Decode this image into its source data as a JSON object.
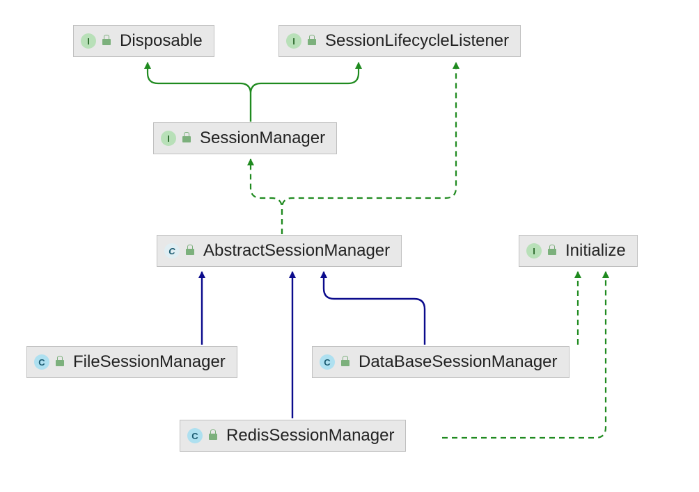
{
  "nodes": {
    "disposable": {
      "label": "Disposable",
      "kind": "interface",
      "badge": "I"
    },
    "sessionLifecycleListener": {
      "label": "SessionLifecycleListener",
      "kind": "interface",
      "badge": "I"
    },
    "sessionManager": {
      "label": "SessionManager",
      "kind": "interface",
      "badge": "I"
    },
    "abstractSessionManager": {
      "label": "AbstractSessionManager",
      "kind": "abstract",
      "badge": "C"
    },
    "initialize": {
      "label": "Initialize",
      "kind": "interface",
      "badge": "I"
    },
    "fileSessionManager": {
      "label": "FileSessionManager",
      "kind": "class",
      "badge": "C"
    },
    "dataBaseSessionManager": {
      "label": "DataBaseSessionManager",
      "kind": "class",
      "badge": "C"
    },
    "redisSessionManager": {
      "label": "RedisSessionManager",
      "kind": "class",
      "badge": "C"
    }
  },
  "edges": [
    {
      "from": "sessionManager",
      "to": "disposable",
      "style": "solid",
      "color": "green"
    },
    {
      "from": "sessionManager",
      "to": "sessionLifecycleListener",
      "style": "solid",
      "color": "green"
    },
    {
      "from": "abstractSessionManager",
      "to": "sessionManager",
      "style": "dashed",
      "color": "green"
    },
    {
      "from": "abstractSessionManager",
      "to": "sessionLifecycleListener",
      "style": "dashed",
      "color": "green"
    },
    {
      "from": "fileSessionManager",
      "to": "abstractSessionManager",
      "style": "solid",
      "color": "navy"
    },
    {
      "from": "dataBaseSessionManager",
      "to": "abstractSessionManager",
      "style": "solid",
      "color": "navy"
    },
    {
      "from": "redisSessionManager",
      "to": "abstractSessionManager",
      "style": "solid",
      "color": "navy"
    },
    {
      "from": "dataBaseSessionManager",
      "to": "initialize",
      "style": "dashed",
      "color": "green"
    },
    {
      "from": "redisSessionManager",
      "to": "initialize",
      "style": "dashed",
      "color": "green"
    }
  ]
}
